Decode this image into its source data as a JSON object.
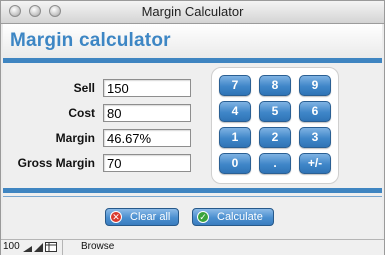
{
  "window": {
    "title": "Margin Calculator"
  },
  "header": {
    "title": "Margin calculator"
  },
  "form": {
    "fields": [
      {
        "label": "Sell",
        "value": "150"
      },
      {
        "label": "Cost",
        "value": "80"
      },
      {
        "label": "Margin",
        "value": "46.67%"
      },
      {
        "label": "Gross Margin",
        "value": "70"
      }
    ]
  },
  "keypad": {
    "keys": [
      "7",
      "8",
      "9",
      "4",
      "5",
      "6",
      "1",
      "2",
      "3",
      "0",
      ".",
      "+/-"
    ]
  },
  "buttons": {
    "clear_label": "Clear all",
    "calculate_label": "Calculate"
  },
  "status": {
    "zoom": "100",
    "mode": "Browse"
  },
  "colors": {
    "accent": "#3f85c1",
    "header_text": "#3d86c4",
    "clear_icon": "#d93a2e",
    "calculate_icon": "#39a33a"
  }
}
